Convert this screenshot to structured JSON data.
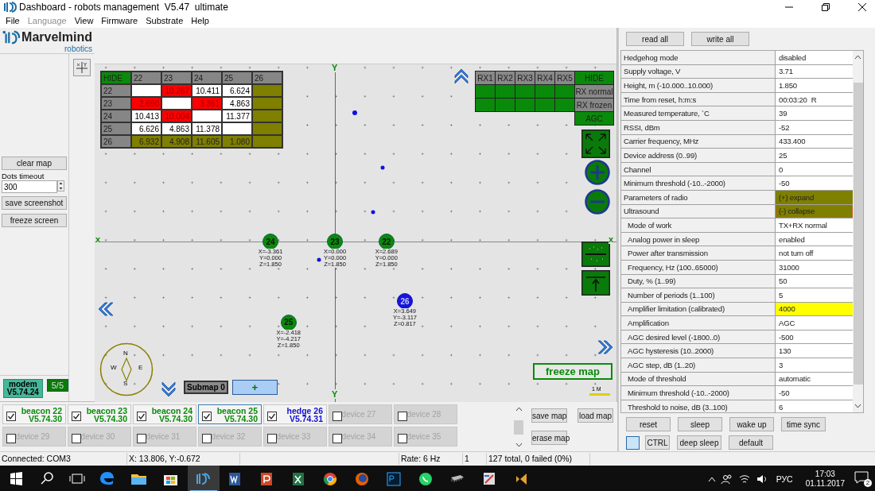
{
  "window": {
    "title": "Dashboard - robots management  V5.47  ultimate"
  },
  "menu": [
    {
      "label": "File",
      "disabled": false
    },
    {
      "label": "Language",
      "disabled": true
    },
    {
      "label": "View",
      "disabled": false
    },
    {
      "label": "Firmware",
      "disabled": false
    },
    {
      "label": "Substrate",
      "disabled": false
    },
    {
      "label": "Help",
      "disabled": false
    }
  ],
  "logo": {
    "name": "Marvelmind",
    "subtitle": "robotics"
  },
  "left_panel": {
    "clear_button": "clear map",
    "dots_timeout": {
      "label": "Dots timeout",
      "value": "300"
    },
    "buttons": [
      "save screenshot",
      "freeze screen"
    ],
    "modem": {
      "label": "modem",
      "version": "V5.74.24",
      "count": "5/5"
    }
  },
  "map": {
    "distance_table": {
      "hide": "HIDE",
      "columns": [
        "22",
        "23",
        "24",
        "25",
        "26"
      ],
      "rows": [
        {
          "label": "22",
          "cells": [
            {
              "kind": "normal"
            },
            {
              "kind": "alert",
              "text": "10.267"
            },
            {
              "kind": "normal",
              "text": "10.411"
            },
            {
              "kind": "normal",
              "text": "6.624"
            },
            {
              "kind": "olive"
            }
          ]
        },
        {
          "label": "23",
          "cells": [
            {
              "kind": "alert",
              "text": "2.690"
            },
            {
              "kind": "normal"
            },
            {
              "kind": "alert",
              "text": "3.361"
            },
            {
              "kind": "normal",
              "text": "4.863"
            },
            {
              "kind": "olive"
            }
          ]
        },
        {
          "label": "24",
          "cells": [
            {
              "kind": "normal",
              "text": "10.413"
            },
            {
              "kind": "alert",
              "text": "10.004"
            },
            {
              "kind": "normal"
            },
            {
              "kind": "normal",
              "text": "11.377"
            },
            {
              "kind": "olive"
            }
          ]
        },
        {
          "label": "25",
          "cells": [
            {
              "kind": "normal",
              "text": "6.626"
            },
            {
              "kind": "normal",
              "text": "4.863"
            },
            {
              "kind": "normal",
              "text": "11.378"
            },
            {
              "kind": "normal"
            },
            {
              "kind": "olive"
            }
          ]
        },
        {
          "label": "26",
          "cells": [
            {
              "kind": "olive",
              "text": "6.932"
            },
            {
              "kind": "olive",
              "text": "4.908"
            },
            {
              "kind": "olive",
              "text": "11.605"
            },
            {
              "kind": "olive",
              "text": "1.080"
            },
            {
              "kind": "olive"
            }
          ]
        }
      ]
    },
    "rx_table": {
      "columns": [
        "RX1",
        "RX2",
        "RX3",
        "RX4",
        "RX5"
      ],
      "rows": [
        {
          "cells": [
            {
              "on": true
            },
            {
              "on": true
            },
            {
              "on": true
            },
            {
              "on": true
            },
            {
              "on": true
            }
          ]
        },
        {
          "cells": [
            {
              "on": true
            },
            {
              "on": true
            },
            {
              "on": true
            },
            {
              "on": true
            },
            {
              "on": true
            }
          ]
        }
      ],
      "buttons": [
        {
          "label": "HIDE",
          "on": true
        },
        {
          "label": "RX normal",
          "on": false
        },
        {
          "label": "RX frozen",
          "on": false
        },
        {
          "label": "AGC",
          "on": true
        }
      ]
    },
    "axis_marks": {
      "y_top": "Y",
      "y_bottom": "Y",
      "x_left": "x",
      "x_right": "x"
    },
    "devices": [
      {
        "id": "24",
        "kind": "beacon",
        "x": "X=-3.361",
        "y": "Y=0.000",
        "z": "Z=1.850"
      },
      {
        "id": "23",
        "kind": "beacon",
        "x": "X=0.000",
        "y": "Y=0.000",
        "z": "Z=1.850"
      },
      {
        "id": "22",
        "kind": "beacon",
        "x": "X=2.689",
        "y": "Y=0.000",
        "z": "Z=1.850"
      },
      {
        "id": "25",
        "kind": "beacon",
        "x": "X=-2.418",
        "y": "Y=-4.217",
        "z": "Z=1.850"
      },
      {
        "id": "26",
        "kind": "hedge",
        "x": "X=3.649",
        "y": "Y=-3.117",
        "z": "Z=0.817"
      }
    ],
    "compass": {
      "n": "N",
      "w": "W",
      "e": "E",
      "s": "S"
    },
    "submap": "Submap 0",
    "add_submap": "+",
    "freeze_button": "freeze map",
    "scale": "1 M"
  },
  "devices": [
    {
      "name": "beacon 22",
      "version": "V5.74.30",
      "kind": "beacon",
      "checked": true,
      "selected": false
    },
    {
      "name": "beacon 23",
      "version": "V5.74.30",
      "kind": "beacon",
      "checked": true,
      "selected": false
    },
    {
      "name": "beacon 24",
      "version": "V5.74.30",
      "kind": "beacon",
      "checked": true,
      "selected": false
    },
    {
      "name": "beacon 25",
      "version": "V5.74.30",
      "kind": "beacon",
      "checked": true,
      "selected": true
    },
    {
      "name": "hedge 26",
      "version": "V5.74.31",
      "kind": "hedge",
      "checked": true,
      "selected": false
    },
    {
      "name": "device 27",
      "kind": "empty",
      "checked": false,
      "selected": false
    },
    {
      "name": "device 28",
      "kind": "empty",
      "checked": false,
      "selected": false
    },
    {
      "name": "device 29",
      "kind": "empty",
      "checked": false,
      "selected": false
    },
    {
      "name": "device 30",
      "kind": "empty",
      "checked": false,
      "selected": false
    },
    {
      "name": "device 31",
      "kind": "empty",
      "checked": false,
      "selected": false
    },
    {
      "name": "device 32",
      "kind": "empty",
      "checked": false,
      "selected": false
    },
    {
      "name": "device 33",
      "kind": "empty",
      "checked": false,
      "selected": false
    },
    {
      "name": "device 34",
      "kind": "empty",
      "checked": false,
      "selected": false
    },
    {
      "name": "device 35",
      "kind": "empty",
      "checked": false,
      "selected": false
    }
  ],
  "map_buttons": {
    "save": "save map",
    "load": "load map",
    "erase": "erase map"
  },
  "right_panel": {
    "buttons": [
      "read all",
      "write all"
    ],
    "properties": [
      {
        "name": "Hedgehog mode",
        "value": "disabled",
        "kind": "normal"
      },
      {
        "name": "Supply voltage, V",
        "value": "3.71",
        "kind": "normal"
      },
      {
        "name": "Height, m (-10.000..10.000)",
        "value": "1.850",
        "kind": "normal"
      },
      {
        "name": "Time from reset, h:m:s",
        "value": "00:03:20  R",
        "kind": "normal"
      },
      {
        "name": "Measured temperature, `C",
        "value": "39",
        "kind": "normal"
      },
      {
        "name": "RSSI, dBm",
        "value": "-52",
        "kind": "normal"
      },
      {
        "name": "Carrier frequency, MHz",
        "value": "433.400",
        "kind": "normal"
      },
      {
        "name": "Device address (0..99)",
        "value": "25",
        "kind": "normal"
      },
      {
        "name": "Channel",
        "value": "0",
        "kind": "normal"
      },
      {
        "name": "Minimum threshold (-10..-2000)",
        "value": "-50",
        "kind": "normal"
      },
      {
        "name": "Parameters of radio",
        "value": "(+) expand",
        "kind": "group",
        "expanded": false
      },
      {
        "name": "Ultrasound",
        "value": "(-) collapse",
        "kind": "group",
        "expanded": true,
        "children": [
          {
            "name": "Mode of work",
            "value": "TX+RX normal",
            "highlighted": false
          },
          {
            "name": "Analog power in sleep",
            "value": "enabled",
            "highlighted": false
          },
          {
            "name": "Power after transmission",
            "value": "not turn off",
            "highlighted": false
          },
          {
            "name": "Frequency, Hz (100..65000)",
            "value": "31000",
            "highlighted": false
          },
          {
            "name": "Duty, % (1..99)",
            "value": "50",
            "highlighted": false
          },
          {
            "name": "Number of periods (1..100)",
            "value": "5",
            "highlighted": false
          },
          {
            "name": "Amplifier limitation (calibrated)",
            "value": "4000",
            "highlighted": true
          },
          {
            "name": "Amplification",
            "value": "AGC",
            "highlighted": false
          },
          {
            "name": "AGC desired level (-1800..0)",
            "value": "-500",
            "highlighted": false
          },
          {
            "name": "AGC hysteresis (10..2000)",
            "value": "130",
            "highlighted": false
          },
          {
            "name": "AGC step, dB (1..20)",
            "value": "3",
            "highlighted": false
          },
          {
            "name": "Mode of threshold",
            "value": "automatic",
            "highlighted": false
          },
          {
            "name": "Minimum threshold (-10..-2000)",
            "value": "-50",
            "highlighted": false
          },
          {
            "name": "Threshold to noise, dB (3..100)",
            "value": "6",
            "highlighted": false
          }
        ]
      }
    ],
    "command_buttons": [
      "reset",
      "sleep",
      "wake up",
      "time sync"
    ],
    "ctrl": {
      "checked": false,
      "label": "CTRL"
    },
    "command_buttons_2": [
      "deep sleep",
      "default"
    ]
  },
  "status_bar": [
    "Connected: COM3",
    "X: 13.806, Y:-0.672",
    "Rate: 6 Hz",
    "1",
    "127 total, 0 failed (0%)"
  ],
  "taskbar": {
    "apps": [
      {
        "selected": false
      },
      {
        "selected": false
      },
      {
        "selected": false
      },
      {
        "selected": true
      },
      {
        "selected": false
      },
      {
        "selected": false
      },
      {
        "selected": false
      },
      {
        "selected": false
      },
      {
        "selected": false
      },
      {
        "selected": false
      },
      {
        "selected": false
      },
      {
        "selected": false
      },
      {
        "selected": false
      },
      {
        "selected": false
      }
    ],
    "language": "РУС",
    "time": "17:03",
    "date": "01.11.2017",
    "notifications": "2"
  }
}
